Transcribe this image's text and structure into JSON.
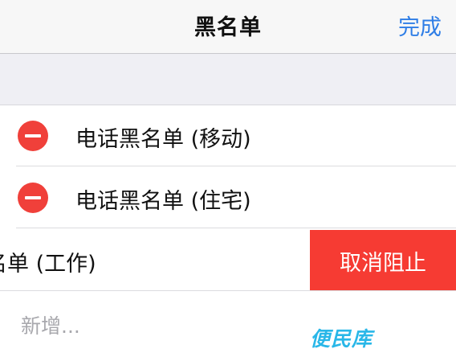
{
  "navbar": {
    "title": "黑名单",
    "done_label": "完成"
  },
  "blocked_list": {
    "items": [
      {
        "label": "电话黑名单 (移动)"
      },
      {
        "label": "电话黑名单 (住宅)"
      },
      {
        "label": "黑名单 (工作)",
        "visible_label": "名单 (工作)",
        "swipe_action": "取消阻止"
      }
    ],
    "add_label": "新增..."
  },
  "watermark": "便民库",
  "colors": {
    "accent": "#2f7ee6",
    "delete_red": "#f0403a",
    "swipe_red": "#f63b33",
    "watermark": "#29b7e8"
  }
}
